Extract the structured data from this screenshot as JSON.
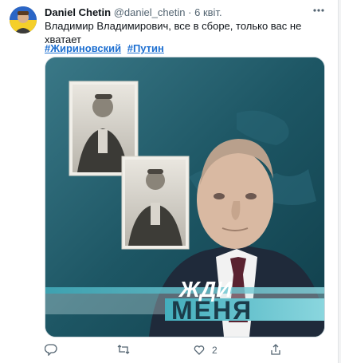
{
  "tweet": {
    "author_name": "Daniel Chetin",
    "author_handle": "@daniel_chetin",
    "separator": "·",
    "timestamp": "6 квіт.",
    "text": "Владимир Владимирович, все в сборе, только вас не хватает",
    "hashtags": [
      "#Жириновский",
      "#Путин"
    ]
  },
  "media": {
    "caption_line1": "ЖДИ",
    "caption_line2": "МЕНЯ"
  },
  "actions": {
    "reply_count": "",
    "retweet_count": "",
    "like_count": "2",
    "share_count": ""
  },
  "colors": {
    "link": "#1d6fd1",
    "muted": "#536471",
    "banner_teal": "#5fc6d0"
  },
  "icons": [
    "more-options-icon",
    "reply-icon",
    "retweet-icon",
    "like-icon",
    "share-icon"
  ]
}
